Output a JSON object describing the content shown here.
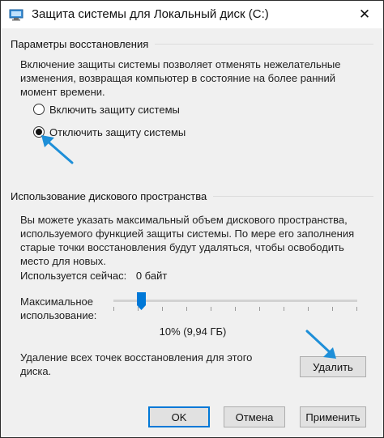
{
  "window": {
    "title": "Защита системы для Локальный диск (C:)",
    "close_glyph": "✕",
    "accent_color": "#0078d7",
    "arrow_color": "#1e8fd8"
  },
  "restore_settings": {
    "heading": "Параметры восстановления",
    "description": "Включение защиты системы позволяет отменять нежелательные изменения, возвращая компьютер в состояние на более ранний момент времени.",
    "options": [
      {
        "label": "Включить защиту системы",
        "selected": false
      },
      {
        "label": "Отключить защиту системы",
        "selected": true
      }
    ]
  },
  "disk_usage": {
    "heading": "Использование дискового пространства",
    "description": "Вы можете указать максимальный объем дискового пространства, используемого функцией защиты системы. По мере его заполнения старые точки восстановления будут удаляться, чтобы освободить место для новых.",
    "current_usage_label": "Используется сейчас:",
    "current_usage_value": "0 байт",
    "max_usage_label": "Максимальное использование:",
    "slider_fraction": 0.1,
    "slider_value_text": "10% (9,94 ГБ)",
    "delete_description": "Удаление всех точек восстановления для этого диска.",
    "delete_button": "Удалить"
  },
  "footer": {
    "ok": "OK",
    "cancel": "Отмена",
    "apply": "Применить"
  },
  "icons": {
    "app": "system-protection-icon",
    "close": "close-icon",
    "arrows": "annotation-arrow-icon"
  }
}
